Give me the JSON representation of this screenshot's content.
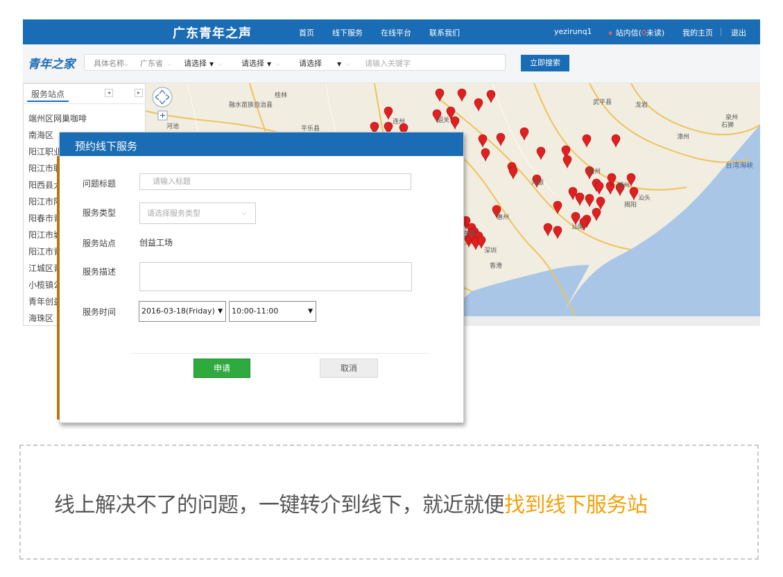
{
  "topbar": {
    "brand": "广东青年之声",
    "nav": [
      "首页",
      "线下服务",
      "在线平台",
      "联系我们"
    ],
    "username": "yezirunq1",
    "messages_label": "站内信(",
    "messages_count": "0",
    "messages_suffix": "未读)",
    "my_home": "我的主页",
    "logout": "退出"
  },
  "searchbar": {
    "logo": "青年之家",
    "filter_name": "具体名称",
    "filter_province": "广东省",
    "filter_select_1": "请选择",
    "filter_select_2": "请选择",
    "filter_select_3": "请选择",
    "keyword_placeholder": "请输入关键字",
    "search_button": "立即搜索"
  },
  "sidebar": {
    "tab": "服务站点",
    "items": [
      "端州区网巢咖啡",
      "南海区",
      "阳江职业",
      "阳江市职",
      "阳西县大",
      "阳江市阳",
      "阳春市青",
      "阳江市城",
      "阳江市青",
      "江城区青",
      "小榄镇公",
      "青年创益",
      "海珠区"
    ]
  },
  "map": {
    "labels": [
      "桂林",
      "融水苗族自治县",
      "河池",
      "平乐县",
      "连州",
      "武平县",
      "龙岩",
      "漳州",
      "泉州",
      "石狮",
      "梅州",
      "潮州",
      "揭阳",
      "汕头",
      "汕尾",
      "惠州",
      "东莞",
      "深圳",
      "香港",
      "河源",
      "韶关"
    ],
    "sea_label": "台湾海峡"
  },
  "modal": {
    "title": "预约线下服务",
    "fields": {
      "subject_label": "问题标题",
      "subject_placeholder": "请输入标题",
      "type_label": "服务类型",
      "type_placeholder": "请选择服务类型",
      "station_label": "服务站点",
      "station_value": "创益工场",
      "desc_label": "服务描述",
      "time_label": "服务时间",
      "date_value": "2016-03-18(Friday)",
      "time_value": "10:00-11:00"
    },
    "apply_button": "申请",
    "cancel_button": "取消"
  },
  "caption": {
    "text": "线上解决不了的问题，一键转介到线下，就近就便",
    "highlight": "找到线下服务站"
  },
  "colors": {
    "primary": "#1a6cb4",
    "apply_green": "#2faa3e",
    "highlight_orange": "#f2a20c",
    "pin_red": "#e02020"
  }
}
